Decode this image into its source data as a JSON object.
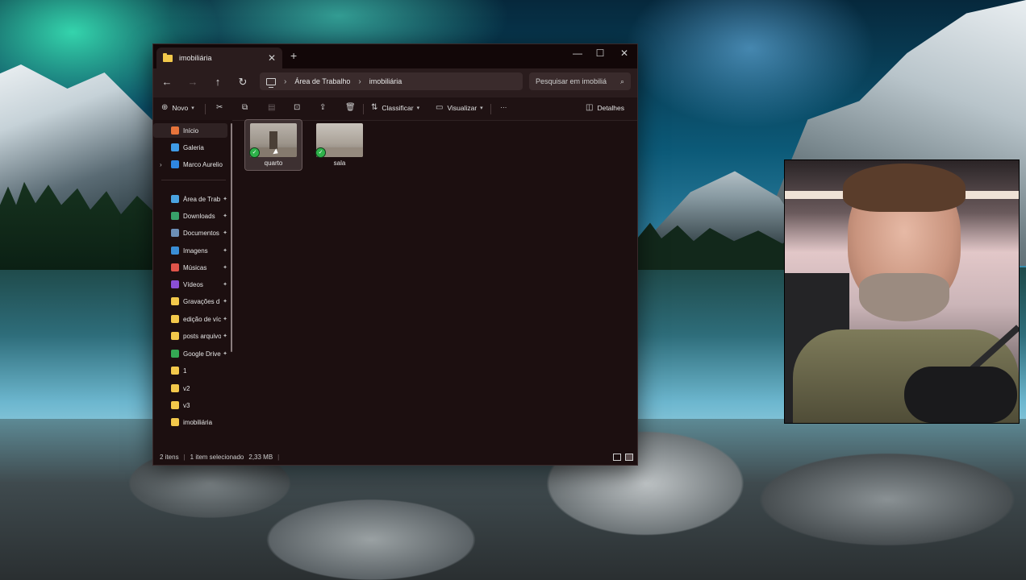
{
  "window": {
    "tab_title": "imobiliária",
    "new_tab": "+",
    "controls": {
      "minimize": "—",
      "maximize": "☐",
      "close": "✕"
    }
  },
  "nav": {
    "back": "←",
    "forward": "→",
    "up": "↑",
    "refresh": "↻",
    "breadcrumb": [
      "Área de Trabalho",
      "imobiliária"
    ],
    "search_placeholder": "Pesquisar em imobiliá"
  },
  "toolbar": {
    "new_label": "Novo",
    "sort_label": "Classificar",
    "view_label": "Visualizar",
    "more_label": "···",
    "details_label": "Detalhes"
  },
  "sidebar": {
    "items": [
      {
        "label": "Início",
        "color": "#e7743b",
        "active": true
      },
      {
        "label": "Galeria",
        "color": "#3f9be6"
      },
      {
        "label": "Marco Aurelio",
        "color": "#2f86e0",
        "expand": "›"
      },
      {
        "label": "Área de Trab",
        "color": "#4aa3e0",
        "pin": true
      },
      {
        "label": "Downloads",
        "color": "#38a169",
        "pin": true
      },
      {
        "label": "Documentos",
        "color": "#6c8fb7",
        "pin": true
      },
      {
        "label": "Imagens",
        "color": "#3a8ed6",
        "pin": true
      },
      {
        "label": "Músicas",
        "color": "#e0544a",
        "pin": true
      },
      {
        "label": "Vídeos",
        "color": "#8a4fd6",
        "pin": true
      },
      {
        "label": "Gravações d",
        "color": "#f2c84b",
        "pin": true
      },
      {
        "label": "edição de víc",
        "color": "#f2c84b",
        "pin": true
      },
      {
        "label": "posts arquivo",
        "color": "#f2c84b",
        "pin": true
      },
      {
        "label": "Google Drive",
        "color": "#34a853",
        "pin": true
      },
      {
        "label": "1",
        "color": "#f2c84b"
      },
      {
        "label": "v2",
        "color": "#f2c84b"
      },
      {
        "label": "v3",
        "color": "#f2c84b"
      },
      {
        "label": "imobiliária",
        "color": "#f2c84b"
      }
    ],
    "pin_glyph": "📌"
  },
  "files": [
    {
      "name": "quarto",
      "selected": true,
      "sync": "✓"
    },
    {
      "name": "sala",
      "selected": false,
      "sync": "✓"
    }
  ],
  "status": {
    "count": "2 itens",
    "selection": "1 item selecionado",
    "size": "2,33 MB"
  }
}
